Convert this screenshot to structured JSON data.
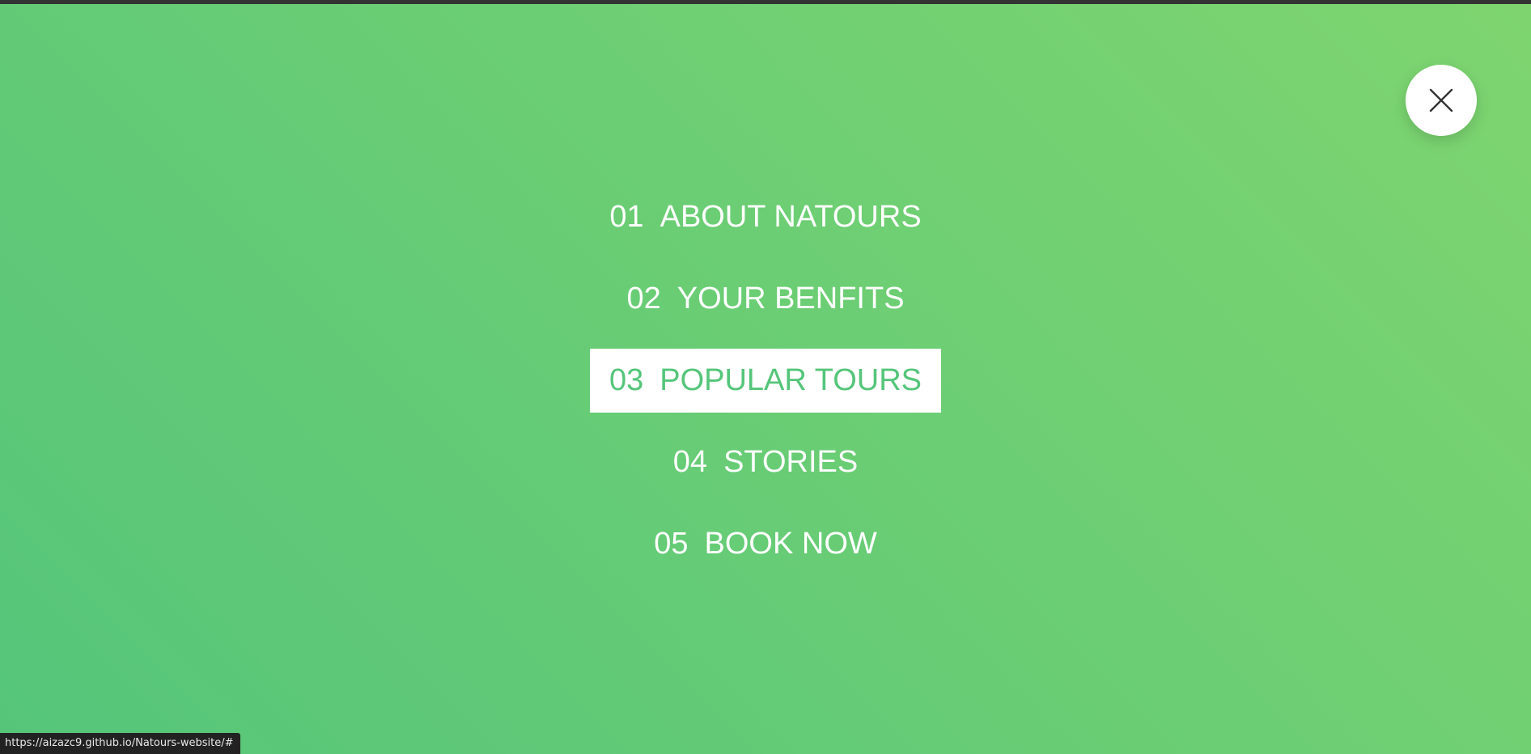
{
  "nav": {
    "items": [
      {
        "number": "01",
        "label": "ABOUT NATOURS"
      },
      {
        "number": "02",
        "label": "YOUR BENFITS"
      },
      {
        "number": "03",
        "label": "POPULAR TOURS"
      },
      {
        "number": "04",
        "label": "STORIES"
      },
      {
        "number": "05",
        "label": "BOOK NOW"
      }
    ],
    "active_index": 2,
    "close_icon": "close-icon"
  },
  "status_bar": {
    "url": "https://aizazc9.github.io/Natours-website/#"
  },
  "colors": {
    "gradient_start": "#55c57a",
    "gradient_end": "#7ed56f",
    "text": "#ffffff",
    "active_bg": "#ffffff",
    "active_text": "#55c57a"
  }
}
